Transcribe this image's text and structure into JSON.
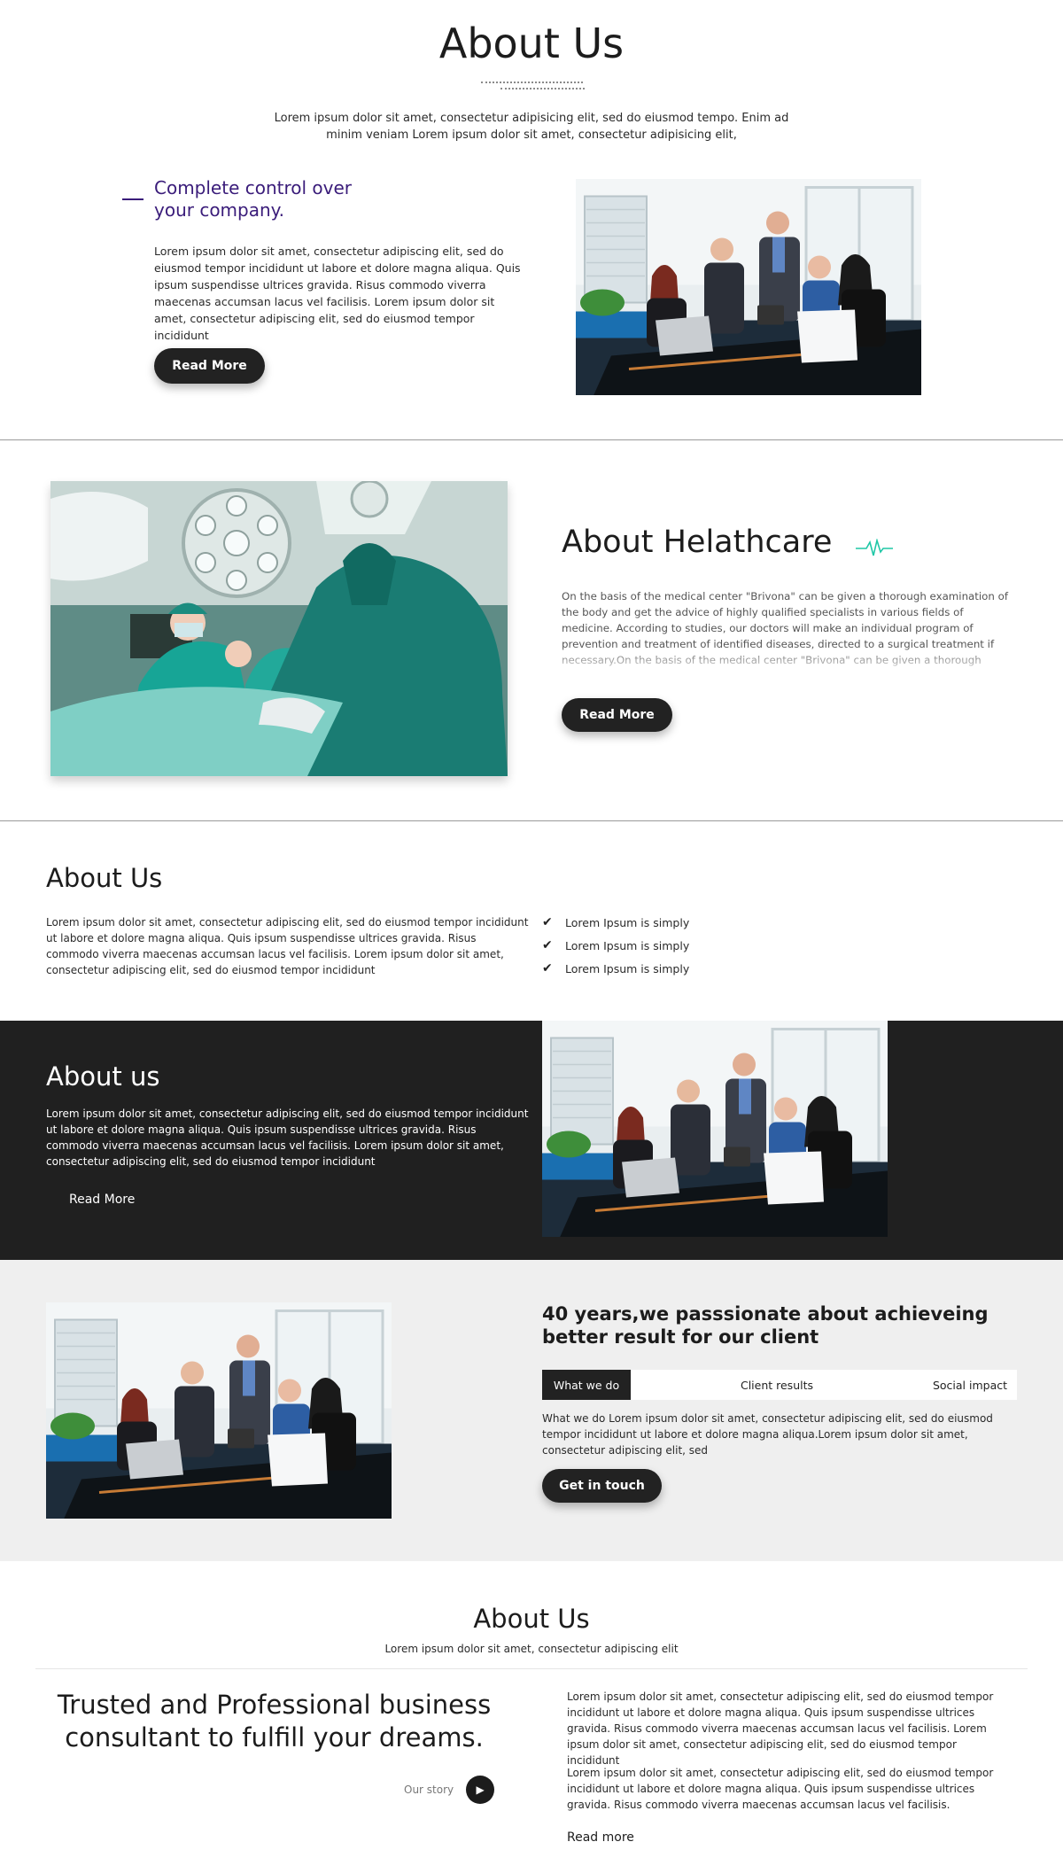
{
  "section1": {
    "title": "About Us",
    "intro": "Lorem ipsum dolor sit amet, consectetur adipisicing elit, sed do eiusmod tempo. Enim ad minim veniam Lorem ipsum dolor sit amet, consectetur adipisicing elit,",
    "subtitle_line1": "Complete control over",
    "subtitle_line2": "your company.",
    "body": "Lorem ipsum dolor sit amet, consectetur adipiscing elit, sed do eiusmod tempor incididunt ut labore et dolore magna aliqua. Quis ipsum suspendisse ultrices gravida. Risus commodo viverra maecenas accumsan lacus vel facilisis. Lorem ipsum dolor sit amet, consectetur adipiscing elit, sed do eiusmod tempor incididunt",
    "button": "Read More",
    "accent": "#3a1c7a"
  },
  "section2": {
    "title": "About Helathcare",
    "body": "On the basis of the medical center \"Brivona\" can be given a thorough examination of the body and get the advice of highly qualified specialists in various fields of medicine. According to studies, our doctors will make an individual program of prevention and treatment of identified diseases, directed to a surgical treatment if necessary.On the basis of the medical center \"Brivona\" can be given a thorough examination of the body and get",
    "button": "Read More",
    "pulse_color": "#1fc7a6"
  },
  "section3": {
    "title": "About Us",
    "body": "Lorem ipsum dolor sit amet, consectetur adipiscing elit, sed do eiusmod tempor incididunt ut labore et dolore magna aliqua. Quis ipsum suspendisse ultrices gravida. Risus commodo viverra maecenas accumsan lacus vel facilisis. Lorem ipsum dolor sit amet, consectetur adipiscing elit, sed do eiusmod tempor incididunt",
    "checklist": [
      "Lorem Ipsum is simply",
      "Lorem Ipsum is simply",
      "Lorem Ipsum is simply"
    ]
  },
  "section4": {
    "title": "About us",
    "body": "Lorem ipsum dolor sit amet, consectetur adipiscing elit, sed do eiusmod tempor incididunt ut labore et dolore magna aliqua. Quis ipsum suspendisse ultrices gravida. Risus commodo viverra maecenas accumsan lacus vel facilisis. Lorem ipsum dolor sit amet, consectetur adipiscing elit, sed do eiusmod tempor incididunt",
    "link": "Read More",
    "background": "#202020"
  },
  "section5": {
    "headline": "40 years,we passsionate about achieveing better result for our client",
    "tabs": [
      "What we do",
      "Client results",
      "Social impact"
    ],
    "body": "What we do Lorem ipsum dolor sit amet, consectetur adipiscing elit, sed do eiusmod tempor incididunt ut labore et dolore magna aliqua.Lorem ipsum dolor sit amet, consectetur adipiscing elit, sed",
    "button": "Get in touch",
    "background": "#efefef"
  },
  "section6": {
    "title": "About Us",
    "subtitle": "Lorem ipsum dolor sit amet, consectetur adipiscing elit",
    "headline": "Trusted and Professional business consultant to fulfill your dreams.",
    "story_label": "Our story",
    "para1": "Lorem ipsum dolor sit amet, consectetur adipiscing elit, sed do eiusmod tempor incididunt ut labore et dolore magna aliqua. Quis ipsum suspendisse ultrices gravida. Risus commodo viverra maecenas accumsan lacus vel facilisis. Lorem ipsum dolor sit amet, consectetur adipiscing elit, sed do eiusmod tempor incididunt",
    "para2": "Lorem ipsum dolor sit amet, consectetur adipiscing elit, sed do eiusmod tempor incididunt ut labore et dolore magna aliqua. Quis ipsum suspendisse ultrices gravida. Risus commodo viverra maecenas accumsan lacus vel facilisis.",
    "read_more": "Read more"
  },
  "icons": {
    "check": "checkmark-icon",
    "play": "play-icon",
    "pulse": "heartbeat-icon"
  }
}
